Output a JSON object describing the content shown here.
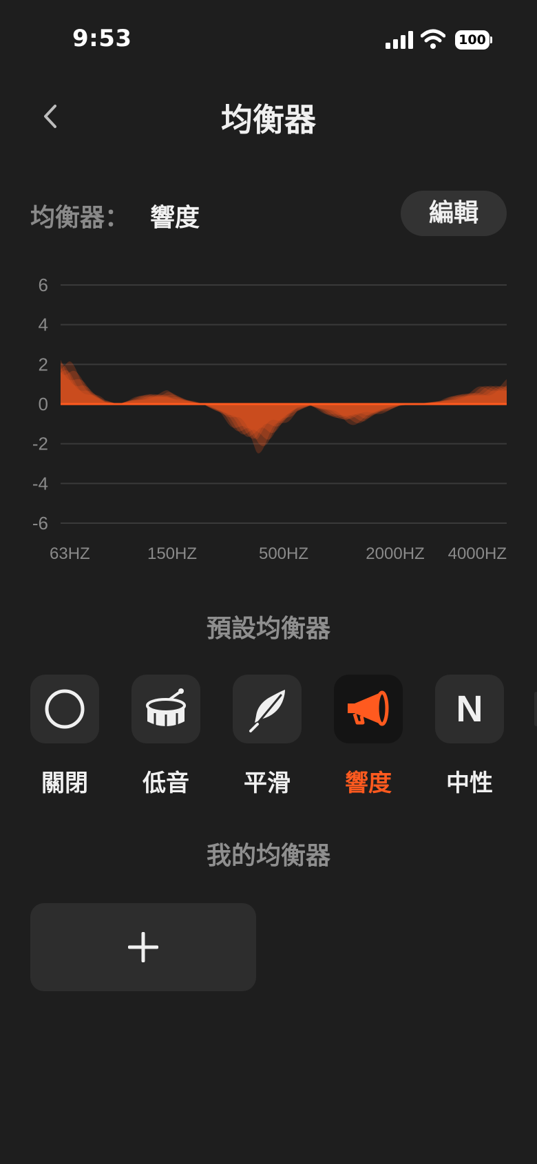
{
  "status_bar": {
    "time": "9:53",
    "battery": "100"
  },
  "nav": {
    "title": "均衡器"
  },
  "equalizer": {
    "label": "均衡器：",
    "current": "響度",
    "edit_label": "編輯"
  },
  "chart_data": {
    "type": "area",
    "y_ticks": [
      "6",
      "4",
      "2",
      "0",
      "-2",
      "-4",
      "-6"
    ],
    "x_tick_labels": [
      "63HZ",
      "150HZ",
      "500HZ",
      "2000HZ",
      "4000HZ"
    ],
    "ylim": [
      -6,
      6
    ],
    "grid": true,
    "fill_color": "#ff5a1f",
    "baseline_color": "#ff5a1f",
    "points": [
      [
        0,
        2.8
      ],
      [
        0.02,
        2.3
      ],
      [
        0.04,
        1.6
      ],
      [
        0.07,
        0.8
      ],
      [
        0.1,
        0.2
      ],
      [
        0.13,
        0.0
      ],
      [
        0.16,
        0.3
      ],
      [
        0.2,
        0.6
      ],
      [
        0.24,
        0.7
      ],
      [
        0.28,
        0.3
      ],
      [
        0.32,
        0.0
      ],
      [
        0.36,
        -0.6
      ],
      [
        0.4,
        -1.6
      ],
      [
        0.44,
        -2.6
      ],
      [
        0.47,
        -2.0
      ],
      [
        0.5,
        -1.2
      ],
      [
        0.53,
        -0.4
      ],
      [
        0.56,
        -0.1
      ],
      [
        0.6,
        -0.6
      ],
      [
        0.64,
        -1.1
      ],
      [
        0.68,
        -1.0
      ],
      [
        0.72,
        -0.5
      ],
      [
        0.76,
        -0.1
      ],
      [
        0.8,
        0.0
      ],
      [
        0.85,
        0.2
      ],
      [
        0.9,
        0.6
      ],
      [
        0.94,
        0.9
      ],
      [
        0.97,
        1.1
      ],
      [
        1.0,
        1.3
      ]
    ]
  },
  "presets_section": {
    "title": "預設均衡器"
  },
  "presets": [
    {
      "label": "關閉",
      "icon": "circle-icon",
      "active": false
    },
    {
      "label": "低音",
      "icon": "drum-icon",
      "active": false
    },
    {
      "label": "平滑",
      "icon": "feather-icon",
      "active": false
    },
    {
      "label": "響度",
      "icon": "megaphone-icon",
      "active": true
    },
    {
      "label": "中性",
      "icon": "n-letter-icon",
      "letter": "N",
      "active": false
    }
  ],
  "my_section": {
    "title": "我的均衡器"
  },
  "colors": {
    "accent": "#ff5a1f",
    "background": "#1e1e1e",
    "tile": "#2d2d2d"
  }
}
